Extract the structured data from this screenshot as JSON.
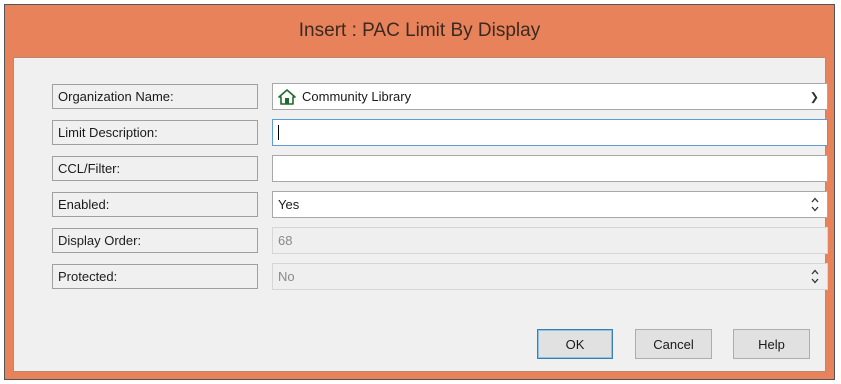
{
  "window": {
    "title": "Insert : PAC Limit By Display"
  },
  "form": {
    "organization": {
      "label": "Organization Name:",
      "value": "Community Library",
      "icon": "house-icon"
    },
    "limit_description": {
      "label": "Limit Description:",
      "value": ""
    },
    "ccl_filter": {
      "label": "CCL/Filter:",
      "value": ""
    },
    "enabled": {
      "label": "Enabled:",
      "value": "Yes"
    },
    "display_order": {
      "label": "Display Order:",
      "value": "68"
    },
    "protected": {
      "label": "Protected:",
      "value": "No"
    }
  },
  "buttons": {
    "ok": "OK",
    "cancel": "Cancel",
    "help": "Help"
  },
  "colors": {
    "title_bar": "#e8825a",
    "client_background": "#f0f0f0",
    "focus_border": "#5f9bd6",
    "house_icon": "#1e6b2a"
  }
}
